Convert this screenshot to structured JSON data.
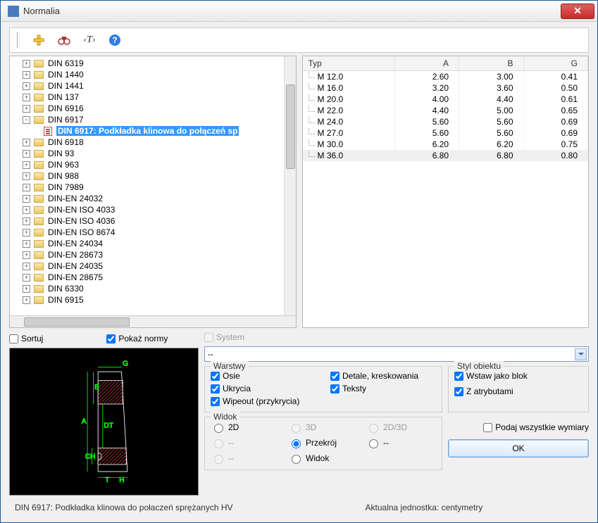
{
  "window": {
    "title": "Normalia"
  },
  "toolbar": {
    "icons": [
      "add-icon",
      "binoculars-icon",
      "text-style-icon",
      "help-icon"
    ]
  },
  "tree": {
    "nodes": [
      {
        "label": "DIN 6319",
        "expandable": true
      },
      {
        "label": "DIN 1440",
        "expandable": true
      },
      {
        "label": "DIN 1441",
        "expandable": true
      },
      {
        "label": "DIN 137",
        "expandable": true
      },
      {
        "label": "DIN 6916",
        "expandable": true
      },
      {
        "label": "DIN 6917",
        "expandable": true,
        "expanded": true,
        "children": [
          {
            "label": "DIN 6917: Podkładka klinowa do połączeń sp",
            "selected": true,
            "doc": true
          }
        ]
      },
      {
        "label": "DIN 6918",
        "expandable": true
      },
      {
        "label": "DIN 93",
        "expandable": true
      },
      {
        "label": "DIN 963",
        "expandable": true
      },
      {
        "label": "DIN 988",
        "expandable": true
      },
      {
        "label": "DIN 7989",
        "expandable": true
      },
      {
        "label": "DIN-EN 24032",
        "expandable": true
      },
      {
        "label": "DIN-EN ISO 4033",
        "expandable": true
      },
      {
        "label": "DIN-EN ISO 4036",
        "expandable": true
      },
      {
        "label": "DIN-EN ISO 8674",
        "expandable": true
      },
      {
        "label": "DIN-EN 24034",
        "expandable": true
      },
      {
        "label": "DIN-EN 28673",
        "expandable": true
      },
      {
        "label": "DIN-EN 24035",
        "expandable": true
      },
      {
        "label": "DIN-EN 28675",
        "expandable": true
      },
      {
        "label": "DIN 6330",
        "expandable": true
      },
      {
        "label": "DIN 6915",
        "expandable": true
      }
    ]
  },
  "tree_options": {
    "sort_label": "Sortuj",
    "sort_checked": false,
    "show_norms_label": "Pokaż normy",
    "show_norms_checked": true
  },
  "table": {
    "columns": [
      "Typ",
      "A",
      "B",
      "G"
    ],
    "rows": [
      {
        "typ": "M 12.0",
        "a": "2.60",
        "b": "3.00",
        "g": "0.41"
      },
      {
        "typ": "M 16.0",
        "a": "3.20",
        "b": "3.60",
        "g": "0.50"
      },
      {
        "typ": "M 20.0",
        "a": "4.00",
        "b": "4.40",
        "g": "0.61"
      },
      {
        "typ": "M 22.0",
        "a": "4.40",
        "b": "5.00",
        "g": "0.65"
      },
      {
        "typ": "M 24.0",
        "a": "5.60",
        "b": "5.60",
        "g": "0.69"
      },
      {
        "typ": "M 27.0",
        "a": "5.60",
        "b": "5.60",
        "g": "0.69"
      },
      {
        "typ": "M 30.0",
        "a": "6.20",
        "b": "6.20",
        "g": "0.75"
      },
      {
        "typ": "M 36.0",
        "a": "6.80",
        "b": "6.80",
        "g": "0.80",
        "selected": true
      }
    ]
  },
  "system": {
    "label": "System",
    "checked": false,
    "combo_value": "--"
  },
  "layers": {
    "legend": "Warstwy",
    "items": [
      {
        "label": "Osie",
        "checked": true
      },
      {
        "label": "Detale, kreskowania",
        "checked": true
      },
      {
        "label": "Ukrycia",
        "checked": true
      },
      {
        "label": "Teksty",
        "checked": true
      },
      {
        "label": "Wipeout (przykrycia)",
        "checked": true
      }
    ]
  },
  "view": {
    "legend": "Widok",
    "options": [
      {
        "label": "2D",
        "enabled": true,
        "selected": false
      },
      {
        "label": "3D",
        "enabled": false,
        "selected": false
      },
      {
        "label": "2D/3D",
        "enabled": false,
        "selected": false
      },
      {
        "label": "--",
        "enabled": false,
        "selected": false
      },
      {
        "label": "Przekrój",
        "enabled": true,
        "selected": true
      },
      {
        "label": "--",
        "enabled": true,
        "selected": false,
        "blank": true
      },
      {
        "label": "--",
        "enabled": false,
        "selected": false
      },
      {
        "label": "Widok",
        "enabled": true,
        "selected": false
      }
    ]
  },
  "style": {
    "legend": "Styl obiektu",
    "insert_block_label": "Wstaw jako blok",
    "insert_block_checked": true,
    "with_attrs_label": "Z atrybutami",
    "with_attrs_checked": true
  },
  "all_dims": {
    "label": "Podaj wszystkie wymiary",
    "checked": false
  },
  "ok_label": "OK",
  "caption": "DIN 6917: Podkładka klinowa do połaczeń sprężanych HV",
  "unit_label": "Aktualna jednostka: centymetry",
  "preview_labels": {
    "G": "G",
    "A": "A",
    "B": "B",
    "DT": "DT",
    "CH": "CH",
    "T": "T",
    "H": "H"
  }
}
